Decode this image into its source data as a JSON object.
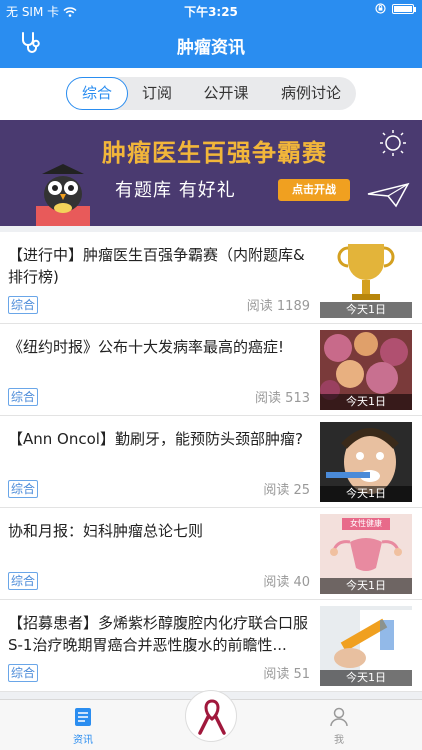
{
  "status_bar": {
    "carrier": "无 SIM 卡",
    "time": "下午3:25"
  },
  "nav": {
    "title": "肿瘤资讯"
  },
  "tabs": [
    {
      "label": "综合",
      "active": true
    },
    {
      "label": "订阅"
    },
    {
      "label": "公开课"
    },
    {
      "label": "病例讨论"
    }
  ],
  "banner": {
    "title": "肿瘤医生百强争霸赛",
    "subtitle": "有题库  有好礼",
    "button": "点击开战"
  },
  "articles": [
    {
      "title": "【进行中】肿瘤医生百强争霸赛（内附题库&排行榜)",
      "tag": "综合",
      "reads": "阅读 1189",
      "badge": "今天1日",
      "thumb": "trophy-thumbnail"
    },
    {
      "title": "《纽约时报》公布十大发病率最高的癌症!",
      "tag": "综合",
      "reads": "阅读 513",
      "badge": "今天1日",
      "thumb": "cells-thumbnail"
    },
    {
      "title": "【Ann Oncol】勤刷牙，能预防头颈部肿瘤?",
      "tag": "综合",
      "reads": "阅读 25",
      "badge": "今天1日",
      "thumb": "toothbrush-thumbnail"
    },
    {
      "title": "协和月报：妇科肿瘤总论七则",
      "tag": "综合",
      "reads": "阅读 40",
      "badge": "今天1日",
      "thumb": "uterus-thumbnail",
      "thumb_label": "女性健康"
    },
    {
      "title": "【招募患者】多烯紫杉醇腹腔内化疗联合口服S-1治疗晚期胃癌合并恶性腹水的前瞻性...",
      "tag": "综合",
      "reads": "阅读 51",
      "badge": "今天1日",
      "thumb": "syringe-thumbnail"
    }
  ],
  "tabbar": {
    "left_label": "资讯",
    "right_label": "我"
  },
  "colors": {
    "primary": "#2a8df0",
    "banner_bg": "#4a3a70",
    "banner_title": "#f2b63a",
    "banner_button": "#f0a020",
    "ribbon": "#a0183c"
  }
}
